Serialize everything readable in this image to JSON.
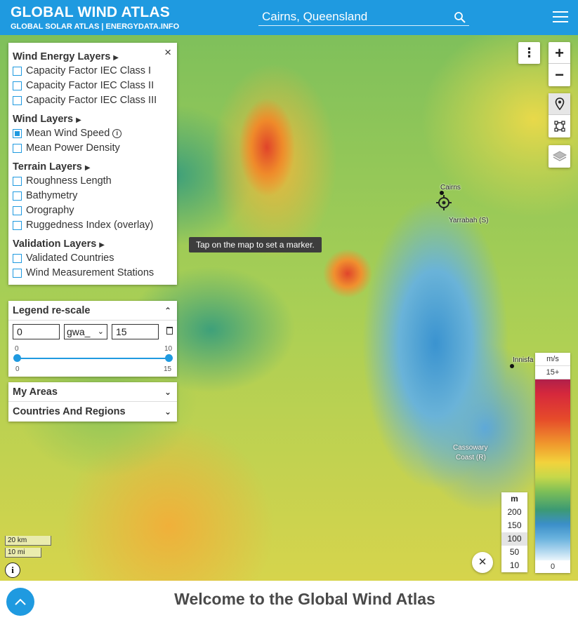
{
  "header": {
    "title": "GLOBAL WIND ATLAS",
    "subtitle": "GLOBAL SOLAR ATLAS | ENERGYDATA.INFO",
    "search_value": "Cairns, Queensland"
  },
  "map": {
    "places": {
      "cairns": "Cairns",
      "yarrabah": "Yarrabah (S)",
      "innisfail": "Innisfa",
      "cassowary": "Cassowary",
      "coast": "Coast (R)"
    },
    "tooltip": "Tap on the map to set a marker.",
    "scale_km": "20 km",
    "scale_mi": "10 mi"
  },
  "panel": {
    "close": "×",
    "groups": [
      {
        "label": "Wind Energy Layers",
        "items": [
          {
            "label": "Capacity Factor IEC Class I",
            "checked": false
          },
          {
            "label": "Capacity Factor IEC Class II",
            "checked": false
          },
          {
            "label": "Capacity Factor IEC Class III",
            "checked": false
          }
        ]
      },
      {
        "label": "Wind Layers",
        "items": [
          {
            "label": "Mean Wind Speed",
            "checked": true
          },
          {
            "label": "Mean Power Density",
            "checked": false
          }
        ]
      },
      {
        "label": "Terrain Layers",
        "items": [
          {
            "label": "Roughness Length",
            "checked": false
          },
          {
            "label": "Bathymetry",
            "checked": false
          },
          {
            "label": "Orography",
            "checked": false
          },
          {
            "label": "Ruggedness Index (overlay)",
            "checked": false
          }
        ]
      },
      {
        "label": "Validation Layers",
        "items": [
          {
            "label": "Validated Countries",
            "checked": false
          },
          {
            "label": "Wind Measurement Stations",
            "checked": false
          }
        ]
      }
    ]
  },
  "rescale": {
    "title": "Legend re-scale",
    "min": "0",
    "palette": "gwa_",
    "max": "15",
    "top_min": "0",
    "top_max": "10",
    "bottom_min": "0",
    "bottom_max": "15"
  },
  "my_areas": "My Areas",
  "countries": "Countries And Regions",
  "heights": {
    "unit": "m",
    "values": [
      "200",
      "150",
      "100",
      "50",
      "10"
    ],
    "selected": "100"
  },
  "legend": {
    "unit": "m/s",
    "top": "15+",
    "bottom": "0"
  },
  "footer": {
    "welcome": "Welcome to the Global Wind Atlas"
  },
  "colors": {
    "accent": "#1f9ae0"
  }
}
